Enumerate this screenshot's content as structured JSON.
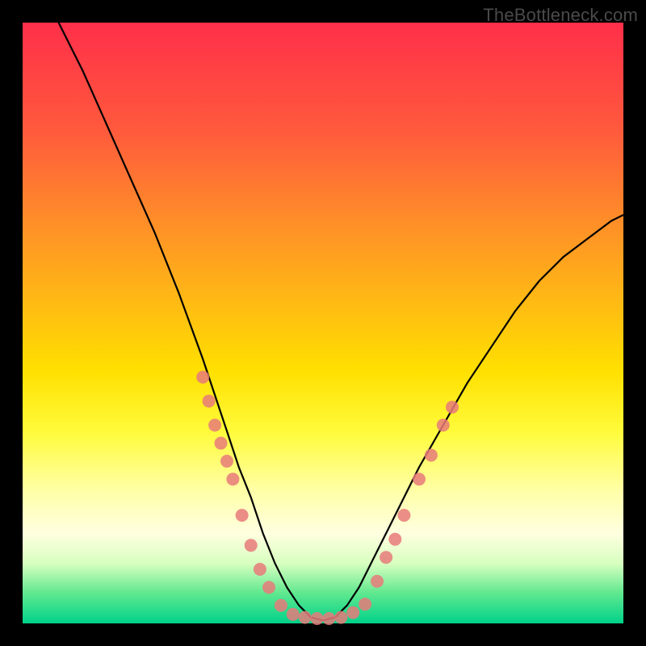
{
  "watermark": "TheBottleneck.com",
  "chart_data": {
    "type": "line",
    "title": "",
    "xlabel": "",
    "ylabel": "",
    "xlim": [
      0,
      100
    ],
    "ylim": [
      0,
      100
    ],
    "grid": false,
    "background_gradient": {
      "top": "#ff2f4a",
      "middle": "#ffe000",
      "bottom": "#00d28a"
    },
    "series": [
      {
        "name": "bottleneck-curve",
        "color": "#000000",
        "x": [
          6,
          10,
          14,
          18,
          22,
          26,
          30,
          34,
          36,
          38,
          40,
          42,
          44,
          46,
          48,
          50,
          52,
          54,
          56,
          58,
          62,
          66,
          70,
          74,
          78,
          82,
          86,
          90,
          94,
          98,
          100
        ],
        "y": [
          100,
          92,
          83,
          74,
          65,
          55,
          44,
          32,
          26,
          21,
          15,
          10,
          6,
          3,
          1,
          0.5,
          1,
          3,
          6,
          10,
          18,
          26,
          33,
          40,
          46,
          52,
          57,
          61,
          64,
          67,
          68
        ]
      }
    ],
    "points": [
      {
        "name": "left-cluster",
        "color": "#e77a7a",
        "r": 8,
        "xy": [
          [
            30,
            41
          ],
          [
            31,
            37
          ],
          [
            32,
            33
          ],
          [
            33,
            30
          ],
          [
            34,
            27
          ],
          [
            35,
            24
          ],
          [
            36.5,
            18
          ],
          [
            38,
            13
          ],
          [
            39.5,
            9
          ],
          [
            41,
            6
          ]
        ]
      },
      {
        "name": "bottom-cluster",
        "color": "#e77a7a",
        "r": 8,
        "xy": [
          [
            43,
            3
          ],
          [
            45,
            1.5
          ],
          [
            47,
            1
          ],
          [
            49,
            0.8
          ],
          [
            51,
            0.8
          ],
          [
            53,
            1
          ],
          [
            55,
            1.8
          ],
          [
            57,
            3.2
          ]
        ]
      },
      {
        "name": "right-cluster",
        "color": "#e77a7a",
        "r": 8,
        "xy": [
          [
            59,
            7
          ],
          [
            60.5,
            11
          ],
          [
            62,
            14
          ],
          [
            63.5,
            18
          ],
          [
            66,
            24
          ],
          [
            68,
            28
          ],
          [
            70,
            33
          ],
          [
            71.5,
            36
          ]
        ]
      }
    ]
  }
}
